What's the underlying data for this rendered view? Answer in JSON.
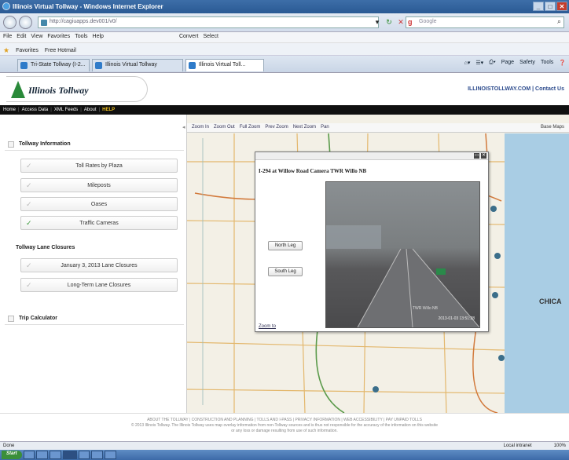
{
  "browser": {
    "title": "Illinois Virtual Tollway - Windows Internet Explorer",
    "url": "http://cagiuapps.dev001/v0/",
    "search_placeholder": "Google",
    "menu": [
      "File",
      "Edit",
      "View",
      "Favorites",
      "Tools",
      "Help"
    ],
    "menu_extras": [
      "Convert",
      "Select"
    ],
    "favorites_label": "Favorites",
    "favorites_items": [
      "Free Hotmail"
    ],
    "tabs": [
      "Tri-State Tollway (I-2...",
      "Illinois Virtual Tollway",
      "Illinois Virtual Toll..."
    ],
    "command_bar": [
      "Page",
      "Safety",
      "Tools"
    ]
  },
  "site": {
    "logo_text": "Illinois Tollway",
    "top_link_main": "ILLINOISTOLLWAY.COM",
    "top_link_sep": " | ",
    "top_link_contact": "Contact Us",
    "nav": [
      "Home",
      "Access Data",
      "XML Feeds",
      "About"
    ],
    "nav_help": "HELP"
  },
  "left_panel": {
    "section_info": "Tollway Information",
    "info_items": [
      {
        "label": "Toll Rates by Plaza",
        "checked": false
      },
      {
        "label": "Mileposts",
        "checked": false
      },
      {
        "label": "Oases",
        "checked": false
      },
      {
        "label": "Traffic Cameras",
        "checked": true
      }
    ],
    "closures_heading": "Tollway Lane Closures",
    "closure_items": [
      {
        "label": "January 3, 2013 Lane Closures",
        "checked": false
      },
      {
        "label": "Long-Term Lane Closures",
        "checked": false
      }
    ],
    "section_trip": "Trip Calculator"
  },
  "map": {
    "toolbar": [
      "Zoom In",
      "Zoom Out",
      "Full Zoom",
      "Prev Zoom",
      "Next Zoom",
      "Pan"
    ],
    "basemaps_label": "Base Maps",
    "city_label": "CHICA"
  },
  "popup": {
    "camera_title": "I-294 at Willow Road   Camera TWR Willo NB",
    "buttons": [
      "North Leg",
      "South Leg"
    ],
    "timestamp": "2013-01-03 13:51:28",
    "overlay_label": "TWR Willo NB",
    "zoom_link": "Zoom to"
  },
  "footer": {
    "links": "ABOUT THE TOLLWAY  |  CONSTRUCTION AND PLANNING  |  TOLLS AND I-PASS  |  PRIVACY INFORMATION  |  WEB ACCESSIBILITY  |  PAY UNPAID TOLLS",
    "disclaimer": "© 2013 Illinois Tollway. The Illinois Tollway uses map overlay information from non-Tollway sources and is thus not responsible for the accuracy of the information on this website",
    "disclaimer2": "or any loss or damage resulting from use of such information."
  },
  "status": {
    "left": "Done",
    "zone": "Local intranet",
    "zoom": "100%"
  },
  "taskbar": {
    "start": "Start"
  }
}
